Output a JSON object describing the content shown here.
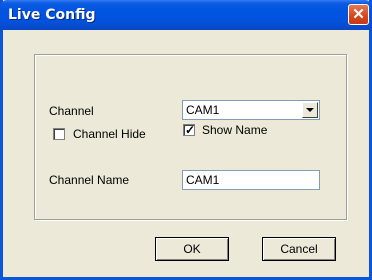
{
  "window": {
    "title": "Live Config",
    "close_icon_glyph": "✕"
  },
  "form": {
    "channel_label": "Channel",
    "channel_value": "CAM1",
    "channel_hide_label": "Channel Hide",
    "channel_hide_checked": false,
    "show_name_label": "Show Name",
    "show_name_checked": true,
    "checkmark_glyph": "✓",
    "channel_name_label": "Channel Name",
    "channel_name_value": "CAM1"
  },
  "buttons": {
    "ok_label": "OK",
    "cancel_label": "Cancel"
  },
  "colors": {
    "titlebar": "#0054e3",
    "close_button": "#d6461c",
    "dialog_bg": "#ece9d8"
  }
}
